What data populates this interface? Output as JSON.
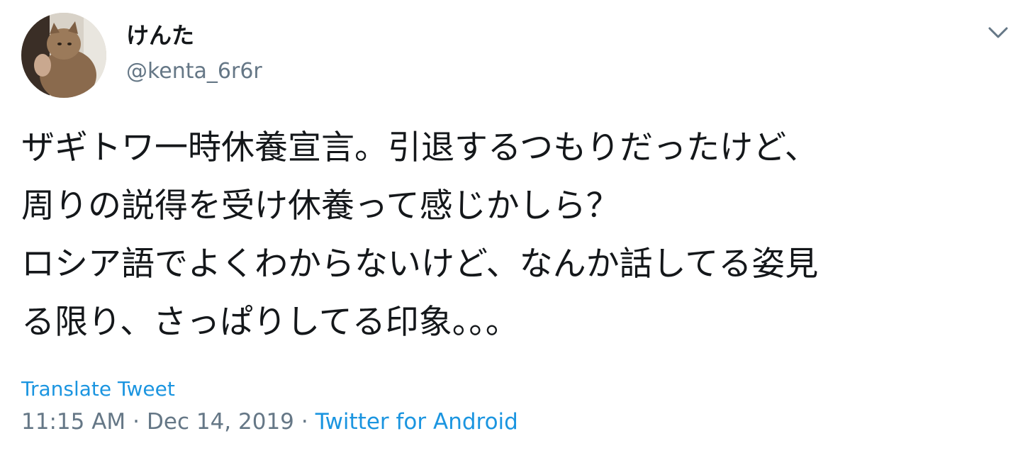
{
  "tweet": {
    "author": {
      "display_name": "けんた",
      "handle": "@kenta_6r6r"
    },
    "text_lines": [
      "ザギトワ一時休養宣言。引退するつもりだったけど、",
      "周りの説得を受け休養って感じかしら？",
      "ロシア語でよくわからないけど、なんか話してる姿見",
      "る限り、さっぱりしてる印象。。。"
    ],
    "translate_label": "Translate Tweet",
    "time": "11:15 AM",
    "date": "Dec 14, 2019",
    "separator": "·",
    "source": "Twitter for Android"
  },
  "icons": {
    "avatar": "avatar",
    "menu": "chevron-down-icon"
  },
  "colors": {
    "text": "#14171a",
    "secondary": "#657786",
    "link": "#1b95e0",
    "background": "#ffffff"
  }
}
